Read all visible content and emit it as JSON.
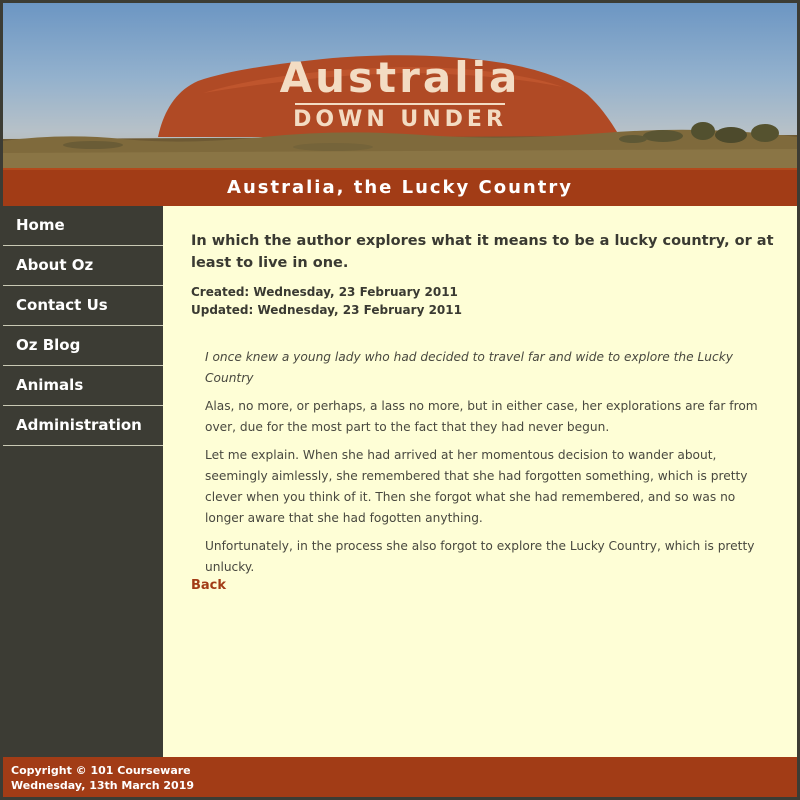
{
  "banner": {
    "title": "Australia",
    "subtitle": "DOWN UNDER"
  },
  "site_title": "Australia, the Lucky Country",
  "nav": {
    "items": [
      {
        "label": "Home"
      },
      {
        "label": "About Oz"
      },
      {
        "label": "Contact Us"
      },
      {
        "label": "Oz Blog"
      },
      {
        "label": "Animals"
      },
      {
        "label": "Administration"
      }
    ]
  },
  "article": {
    "headline": "In which the author explores what it means to be a lucky country, or at least to live in one.",
    "created": "Created: Wednesday, 23 February 2011",
    "updated": "Updated: Wednesday, 23 February 2011",
    "paragraphs": [
      "I once knew a young lady who had decided to travel far and wide to explore the Lucky Country",
      "Alas, no more, or perhaps, a lass no more, but in either case, her explorations are far from over, due for the most part to the fact that they had never begun.",
      "Let me explain. When she had arrived at her momentous decision to wander about, seemingly aimlessly, she remembered that she had forgotten something, which is pretty clever when you think of it. Then she forgot what she had remembered, and so was no longer aware that she had fogotten anything.",
      "Unfortunately, in the process she also forgot to explore the Lucky Country, which is pretty unlucky."
    ],
    "back_label": "Back"
  },
  "footer": {
    "copyright": "Copyright © 101 Courseware",
    "date": "Wednesday, 13th March 2019"
  },
  "colors": {
    "accent": "#a23c16",
    "sidebar": "#3c3c34",
    "content_bg": "#fefed6"
  }
}
